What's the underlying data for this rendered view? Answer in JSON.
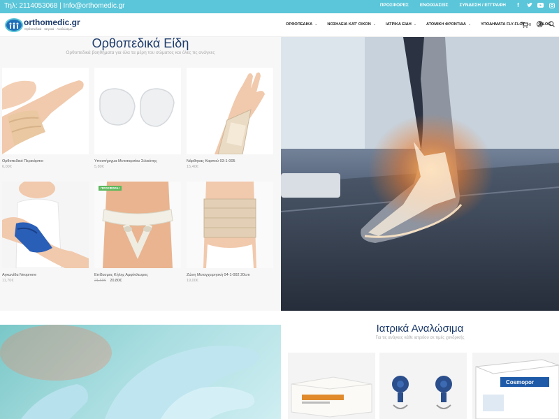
{
  "topbar": {
    "contact": "Τηλ: 2114053068 | Info@orthomedic.gr",
    "links": [
      "ΠΡΟΣΦΟΡΕΣ",
      "ΕΝΟΙΧΙΑΣΕΙΣ",
      "ΣΥΝΔΕΣΗ / ΕΓΓΡΑΦΗ"
    ],
    "social": [
      "facebook-icon",
      "twitter-icon",
      "youtube-icon",
      "instagram-icon"
    ]
  },
  "logo": {
    "name": "orthomedic.gr",
    "tagline": "Ορθοπεδικά · Ιατρικά · Αναλώσιμα"
  },
  "menu": [
    {
      "label": "ΟΡΘΟΠΕΔΙΚΑ",
      "dropdown": true
    },
    {
      "label": "ΝΟΣΗΛΕΙΑ ΚΑΤ' ΟΙΚΟΝ",
      "dropdown": true
    },
    {
      "label": "ΙΑΤΡΙΚΑ ΕΙΔΗ",
      "dropdown": true
    },
    {
      "label": "ΑΤΟΜΙΚΗ ΦΡΟΝΤΙΔΑ",
      "dropdown": true
    },
    {
      "label": "ΥΠΟΔΗΜΑΤΑ FLY-FLOT",
      "dropdown": true
    },
    {
      "label": "BLOG",
      "dropdown": false
    }
  ],
  "cart": {
    "count": "0"
  },
  "section1": {
    "title": "Ορθοπεδικά Είδη",
    "subtitle": "Ορθοπεδικά βοηθήματα για όλα τα μέρη του σώματος και όλες τις ανάγκες"
  },
  "products": [
    {
      "name": "Ορθοπεδικό Περικάρπιο",
      "price": "6,00€"
    },
    {
      "name": "Υποστήριγμα Μεταταρσίου Σιλικόνης",
      "price": "5,80€"
    },
    {
      "name": "Νάρθηκας Καρπού 03-1-005",
      "price": "15,40€"
    },
    {
      "name": "Αγκωνίδα Neoprene",
      "price": "11,70€"
    },
    {
      "name": "Επίδεσμος Κήλης Αμφίπλευρος",
      "old_price": "21,60€",
      "price": "20,80€",
      "badge": "ΠΡΟΣΦΟΡΑ!"
    },
    {
      "name": "Ζώνη Μεταγχειρητική 04-1-002 20cm",
      "price": "19,00€"
    }
  ],
  "section2": {
    "title": "Ιατρικά Αναλώσιμα",
    "subtitle": "Για τις ανάγκες κάθε ιατρείου σε τιμές χονδρικής",
    "box3_brand": "Cosmopor"
  },
  "colors": {
    "topbar": "#5bc6d9",
    "heading": "#1d3b6b",
    "sale": "#5cb85c"
  }
}
